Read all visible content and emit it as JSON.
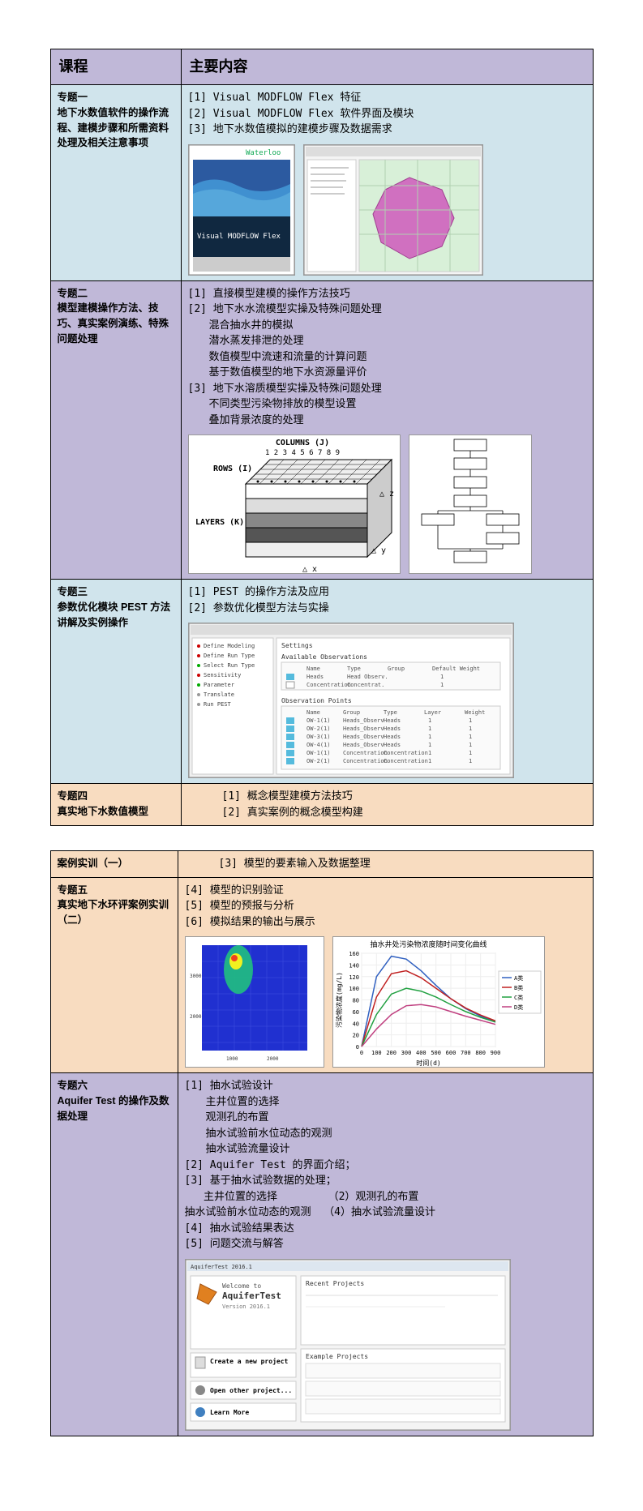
{
  "header": {
    "col1": "课程",
    "col2": "主要内容"
  },
  "rows": [
    {
      "bg": "bg-blue",
      "topic_num": "专题一",
      "topic_title": "地下水数值软件的操作流程、建模步骤和所需资料处理及相关注意事项",
      "items": [
        "[1] Visual MODFLOW Flex 特征",
        "[2] Visual MODFLOW Flex 软件界面及模块",
        "[3] 地下水数值模拟的建模步骤及数据需求"
      ],
      "img_labels": {
        "brand": "Waterloo",
        "product": "Visual MODFLOW Flex"
      },
      "has_img": "a"
    },
    {
      "bg": "bg-purple",
      "topic_num": "专题二",
      "topic_title": "模型建模操作方法、技巧、真实案例演练、特殊问题处理",
      "items": [
        "[1] 直接模型建模的操作方法技巧",
        "[2] 地下水水流模型实操及特殊问题处理",
        "    混合抽水井的模拟",
        "    潜水蒸发排泄的处理",
        "    数值模型中流速和流量的计算问题",
        "    基于数值模型的地下水资源量评价",
        "[3] 地下水溶质模型实操及特殊问题处理",
        "    不同类型污染物排放的模型设置",
        "    叠加背景浓度的处理"
      ],
      "img_labels": {
        "columns": "COLUMNS (J)",
        "rows": "ROWS (I)",
        "layers": "LAYERS (K)",
        "dx": "△ x",
        "dy": "△ y",
        "dz": "△ z",
        "nums": "1 2 3 4 5 6 7 8 9"
      },
      "has_img": "b"
    },
    {
      "bg": "bg-blue",
      "topic_num": "专题三",
      "topic_title": "参数优化模块 PEST 方法讲解及实例操作",
      "items": [
        "[1] PEST 的操作方法及应用",
        "[2] 参数优化模型方法与实操"
      ],
      "has_img": "c"
    },
    {
      "bg": "bg-orange",
      "topic_num": "专题四",
      "topic_title": "真实地下水数值模型",
      "items": [
        "[1] 概念模型建模方法技巧",
        "[2] 真实案例的概念模型构建"
      ],
      "indent": true
    }
  ],
  "table2_rows": [
    {
      "bg": "bg-orange",
      "topic_num": "案例实训（一）",
      "topic_title": "",
      "items": [
        "[3] 模型的要素输入及数据整理"
      ],
      "indent": true
    },
    {
      "bg": "bg-orange",
      "topic_num": "专题五",
      "topic_title": "真实地下水环评案例实训（二）",
      "items": [
        "[4] 模型的识别验证",
        "[5] 模型的预报与分析",
        "[6] 模拟结果的输出与展示"
      ],
      "has_img": "d"
    },
    {
      "bg": "bg-purple",
      "topic_num": "专题六",
      "topic_title": "Aquifer Test 的操作及数据处理",
      "items": [
        "[1] 抽水试验设计",
        "   主井位置的选择",
        "   观测孔的布置",
        "   抽水试验前水位动态的观测",
        "   抽水试验流量设计",
        "[2] Aquifer Test 的界面介绍；",
        "[3] 基于抽水试验数据的处理；",
        "   主井位置的选择        （2）观测孔的布置",
        "抽水试验前水位动态的观测  （4）抽水试验流量设计",
        "[4] 抽水试验结果表达",
        "[5] 问题交流与解答"
      ],
      "has_img": "e",
      "img_labels": {
        "welcome": "Welcome to",
        "product": "AquiferTest",
        "version": "Version 2016.1",
        "recent": "Recent Projects",
        "example": "Example Projects",
        "create": "Create a new project",
        "open": "Open other project...",
        "learn": "Learn More"
      }
    }
  ],
  "chart_data": {
    "type": "line",
    "title": "抽水井处污染物浓度随时间变化曲线",
    "xlabel": "时间(d)",
    "ylabel": "污染物浓度(mg/L)",
    "x": [
      0,
      100,
      200,
      300,
      400,
      500,
      600,
      700,
      800,
      900
    ],
    "ylim": [
      0,
      160
    ],
    "xlim": [
      0,
      900
    ],
    "yticks": [
      0,
      20,
      40,
      60,
      80,
      100,
      120,
      140,
      160
    ],
    "series": [
      {
        "name": "A类",
        "color": "#3060c0",
        "values": [
          0,
          120,
          155,
          150,
          130,
          105,
          82,
          65,
          52,
          42
        ]
      },
      {
        "name": "B类",
        "color": "#c02020",
        "values": [
          0,
          85,
          125,
          130,
          118,
          100,
          82,
          66,
          54,
          44
        ]
      },
      {
        "name": "C类",
        "color": "#20a040",
        "values": [
          0,
          55,
          90,
          100,
          95,
          85,
          72,
          60,
          50,
          42
        ]
      },
      {
        "name": "D类",
        "color": "#c04080",
        "values": [
          0,
          30,
          55,
          70,
          72,
          68,
          60,
          52,
          45,
          38
        ]
      }
    ]
  }
}
